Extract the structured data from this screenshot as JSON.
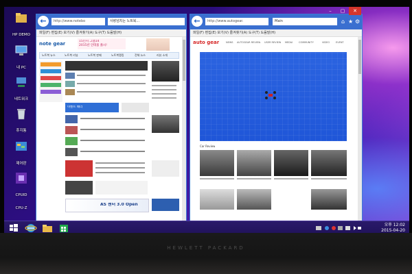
{
  "desktop": {
    "icons": [
      {
        "name": "hp-demo-hub",
        "label": "HP DEMO\nHUB"
      },
      {
        "name": "my-pc",
        "label": "내 PC"
      },
      {
        "name": "network",
        "label": "네트워크"
      },
      {
        "name": "recycle-bin",
        "label": "휴지통"
      },
      {
        "name": "control-panel",
        "label": "제어판"
      },
      {
        "name": "cpuid-cpuz",
        "label": "CPUID\nCPU-Z"
      }
    ]
  },
  "left_browser": {
    "address": "http://www.notebo",
    "tab_title": "사랑넘치는 노트북...",
    "menu": "파일(F)  편집(E)  보기(V)  즐겨찾기(A)  도구(T)  도움말(H)",
    "site_logo": "note gear",
    "site_tagline": "notebook",
    "promo_banner": "15인치 그램14\n2015년 인테올 출시!",
    "nav_items": [
      "노트북 뉴스",
      "노트북 리뷰",
      "노트북 판매",
      "노트북랭킹",
      "전체 뉴스",
      "리뷰 소개"
    ],
    "banner_event": "이벤트 배너",
    "ad_banner_text": "AS 센터   3.0 Open"
  },
  "right_browser": {
    "address": "http://www.autogear.",
    "tab_title": "Main",
    "menu": "파일(F)  편집(E)  보기(V)  즐겨찾기(A)  도구(T)  도움말(H)",
    "site_logo": "auto gear",
    "nav_items": [
      "NEWS",
      "AUTOGEAR REVIEW",
      "USER REVIEW",
      "MEDIA",
      "COMMUNITY",
      "VIDEO",
      "EVENT"
    ],
    "section_label": "Car Review"
  },
  "window_controls": {
    "minimize": "–",
    "maximize": "▢",
    "close": "✕"
  },
  "taskbar": {
    "clock_time": "오후 12:02",
    "clock_date": "2015-04-20"
  },
  "brand": "HEWLETT PACKARD"
}
